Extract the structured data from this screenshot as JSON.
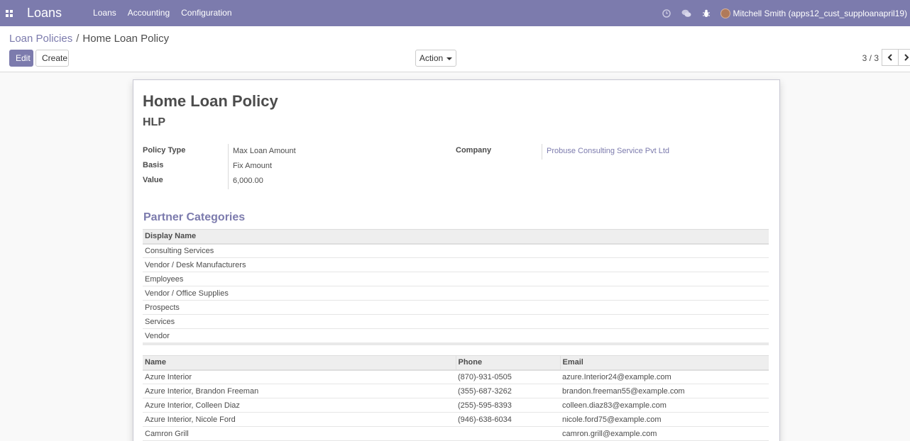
{
  "navbar": {
    "brand": "Loans",
    "menu": [
      "Loans",
      "Accounting",
      "Configuration"
    ],
    "icons": [
      "apps-icon",
      "clock-icon",
      "chat-icon",
      "bug-icon"
    ],
    "user": "Mitchell Smith (apps12_cust_supploanapril19)",
    "color": "#7c7bad"
  },
  "breadcrumb": {
    "parent": "Loan Policies",
    "separator": "/",
    "current": "Home Loan Policy"
  },
  "buttons": {
    "edit": "Edit",
    "create": "Create",
    "action": "Action"
  },
  "pager": {
    "value": "3 / 3"
  },
  "record": {
    "title": "Home Loan Policy",
    "code": "HLP",
    "fields": {
      "policy_type_label": "Policy Type",
      "policy_type": "Max Loan Amount",
      "basis_label": "Basis",
      "basis": "Fix Amount",
      "value_label": "Value",
      "value": "6,000.00",
      "company_label": "Company",
      "company": "Probuse Consulting Service Pvt Ltd"
    }
  },
  "partner_categories": {
    "title": "Partner Categories",
    "header": "Display Name",
    "rows": [
      "Consulting Services",
      "Vendor / Desk Manufacturers",
      "Employees",
      "Vendor / Office Supplies",
      "Prospects",
      "Services",
      "Vendor"
    ]
  },
  "partners": {
    "headers": [
      "Name",
      "Phone",
      "Email"
    ],
    "rows": [
      {
        "name": "Azure Interior",
        "phone": "(870)-931-0505",
        "email": "azure.Interior24@example.com"
      },
      {
        "name": "Azure Interior, Brandon Freeman",
        "phone": "(355)-687-3262",
        "email": "brandon.freeman55@example.com"
      },
      {
        "name": "Azure Interior, Colleen Diaz",
        "phone": "(255)-595-8393",
        "email": "colleen.diaz83@example.com"
      },
      {
        "name": "Azure Interior, Nicole Ford",
        "phone": "(946)-638-6034",
        "email": "nicole.ford75@example.com"
      },
      {
        "name": "Camron Grill",
        "phone": "",
        "email": "camron.grill@example.com"
      }
    ]
  }
}
